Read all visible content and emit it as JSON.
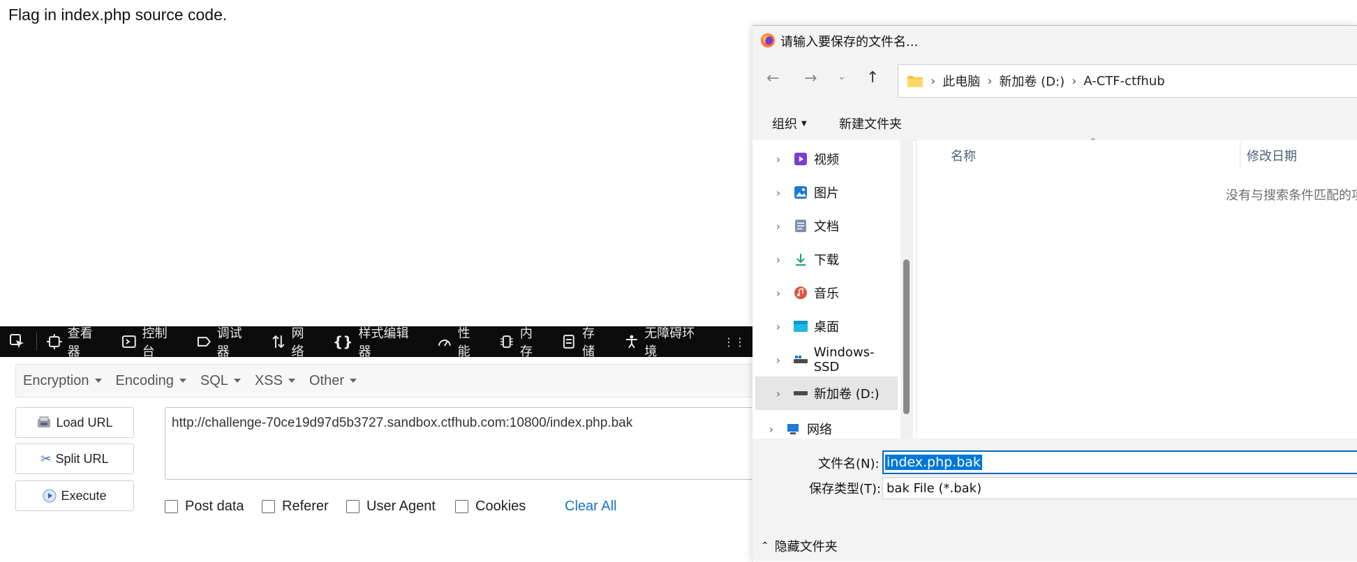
{
  "page": {
    "text": "Flag in index.php source code."
  },
  "devtools": {
    "tabs": [
      {
        "label": "查看器",
        "icon": "inspector-icon"
      },
      {
        "label": "控制台",
        "icon": "console-icon"
      },
      {
        "label": "调试器",
        "icon": "debugger-icon"
      },
      {
        "label": "网络",
        "icon": "network-icon"
      },
      {
        "label": "样式编辑器",
        "icon": "style-editor-icon"
      },
      {
        "label": "性能",
        "icon": "performance-icon"
      },
      {
        "label": "内存",
        "icon": "memory-icon"
      },
      {
        "label": "存储",
        "icon": "storage-icon"
      },
      {
        "label": "无障碍环境",
        "icon": "accessibility-icon"
      }
    ]
  },
  "hackbar": {
    "menu": [
      "Encryption",
      "Encoding",
      "SQL",
      "XSS",
      "Other"
    ],
    "buttons": {
      "load": "Load URL",
      "split": "Split URL",
      "execute": "Execute"
    },
    "url": "http://challenge-70ce19d97d5b3727.sandbox.ctfhub.com:10800/index.php.bak",
    "checkboxes": [
      "Post data",
      "Referer",
      "User Agent",
      "Cookies"
    ],
    "clear_all": "Clear All"
  },
  "dialog": {
    "title": "请输入要保存的文件名...",
    "breadcrumb": [
      "此电脑",
      "新加卷 (D:)",
      "A-CTF-ctfhub"
    ],
    "commands": {
      "organize": "组织",
      "new_folder": "新建文件夹"
    },
    "tree": [
      {
        "label": "视频",
        "icon": "videos-icon"
      },
      {
        "label": "图片",
        "icon": "pictures-icon"
      },
      {
        "label": "文档",
        "icon": "documents-icon"
      },
      {
        "label": "下载",
        "icon": "downloads-icon"
      },
      {
        "label": "音乐",
        "icon": "music-icon"
      },
      {
        "label": "桌面",
        "icon": "desktop-icon"
      },
      {
        "label": "Windows-SSD",
        "icon": "drive-icon"
      },
      {
        "label": "新加卷 (D:)",
        "icon": "drive-icon",
        "selected": true
      },
      {
        "label": "网络",
        "icon": "network-folder-icon"
      }
    ],
    "columns": {
      "name": "名称",
      "modified": "修改日期"
    },
    "empty_message": "没有与搜索条件匹配的项",
    "filename_label": "文件名(N):",
    "filename_value": "index.php.bak",
    "filetype_label": "保存类型(T):",
    "filetype_value": "bak File (*.bak)",
    "hide_folders": "隐藏文件夹"
  },
  "colors": {
    "devtools_bg": "#0c0c0d",
    "accent_blue": "#0078d7",
    "link_blue": "#1a73c9"
  }
}
